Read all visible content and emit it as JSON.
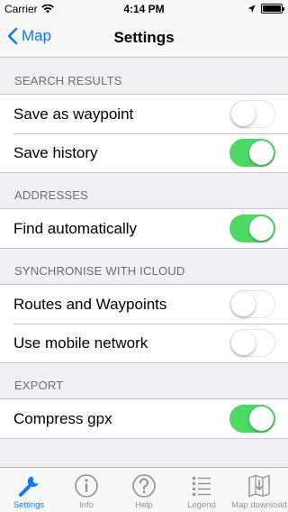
{
  "status_bar": {
    "carrier": "Carrier",
    "time": "4:14 PM"
  },
  "nav": {
    "back_label": "Map",
    "title": "Settings"
  },
  "sections": [
    {
      "header": "SEARCH RESULTS",
      "rows": [
        {
          "label": "Save as waypoint",
          "on": false
        },
        {
          "label": "Save history",
          "on": true
        }
      ]
    },
    {
      "header": "ADDRESSES",
      "rows": [
        {
          "label": "Find automatically",
          "on": true
        }
      ]
    },
    {
      "header": "SYNCHRONISE WITH ICLOUD",
      "rows": [
        {
          "label": "Routes and Waypoints",
          "on": false
        },
        {
          "label": "Use mobile network",
          "on": false
        }
      ]
    },
    {
      "header": "EXPORT",
      "rows": [
        {
          "label": "Compress gpx",
          "on": true
        }
      ]
    }
  ],
  "tabs": [
    {
      "label": "Settings",
      "icon": "wrench-icon",
      "active": true
    },
    {
      "label": "Info",
      "icon": "info-icon",
      "active": false
    },
    {
      "label": "Help",
      "icon": "help-icon",
      "active": false
    },
    {
      "label": "Legend",
      "icon": "legend-icon",
      "active": false
    },
    {
      "label": "Map download",
      "icon": "map-download-icon",
      "active": false
    }
  ],
  "colors": {
    "accent": "#0a7aff",
    "toggle_on": "#4cd964",
    "background": "#efeff4"
  }
}
